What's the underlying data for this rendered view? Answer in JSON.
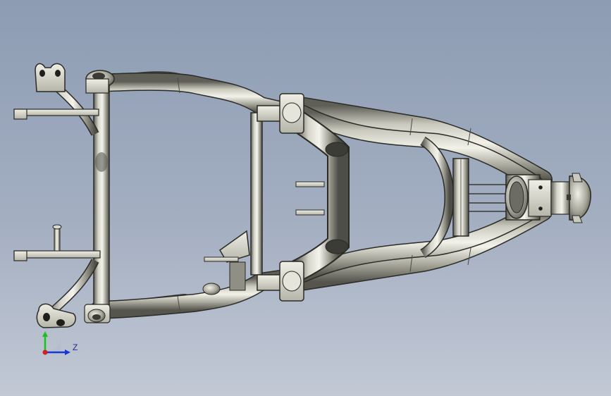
{
  "viewport": {
    "background_top": "#8d9cb3",
    "background_bottom": "#c2c9d5",
    "model_name": "motorcycle-swingarm-frame"
  },
  "triad": {
    "z_label": "Z",
    "y_axis_color": "#19c21e",
    "z_axis_color": "#1a35d6",
    "origin_color": "#d12020"
  },
  "colors": {
    "tube_light": "#e6e6dc",
    "tube_mid": "#b4b4a6",
    "tube_dark": "#6e6e66",
    "outline": "#2a2a26"
  }
}
